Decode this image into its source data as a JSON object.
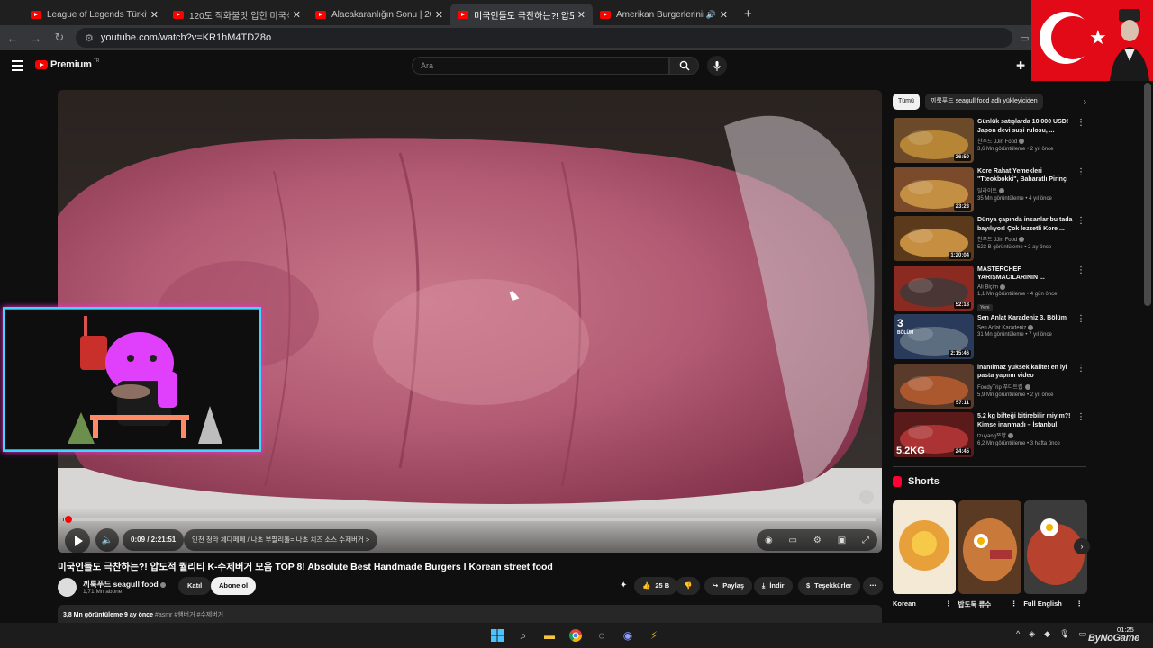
{
  "browser": {
    "tabs": [
      {
        "title": "League of Legends Türkiye - Yo",
        "active": false,
        "audio": false
      },
      {
        "title": "120도 직화불맛 입힌 미국식 옥",
        "active": false,
        "audio": false
      },
      {
        "title": "Alacakaranlığın Sonu | 2025 3.",
        "active": false,
        "audio": false
      },
      {
        "title": "미국인들도 극찬하는?! 압도적",
        "active": true,
        "audio": false
      },
      {
        "title": "Amerikan Burgerlerinin Kral",
        "active": false,
        "audio": true
      }
    ],
    "url": "youtube.com/watch?v=KR1hM4TDZ8o"
  },
  "youtube": {
    "logo": "Premium",
    "logo_region": "TR",
    "search_placeholder": "Ara"
  },
  "player": {
    "time": "0:09 / 2:21:51",
    "chapter": "인천 청라 체다페페 / 나초 부팔리톨= 나초 치즈 소스 수제버거 >",
    "progress_fraction": 0.0016
  },
  "video": {
    "title": "미국인들도 극찬하는?! 압도적 퀄리티 K-수제버거 모음 TOP 8! Absolute Best Handmade Burgers l Korean street food",
    "channel": "끼룩푸드 seagull food",
    "subscribers": "1,71 Mn abone",
    "join": "Katıl",
    "subscribe": "Abone ol",
    "likes": "25 B",
    "share": "Paylaş",
    "download": "İndir",
    "thanks": "Teşekkürler",
    "views_date": "3,8 Mn görüntüleme  9 ay önce",
    "tags": "#asmr #햄버거 #수제버거"
  },
  "sidebar": {
    "chips": [
      "Tümü",
      "끼룩푸드 seagull food adlı yükleyiciden"
    ],
    "recommendations": [
      {
        "title": "Günlük satışlarda 10.000 USD! Japon devi suşi rulosu, ...",
        "channel": "찬푸드 JJin Food",
        "meta": "3,6 Mn görüntüleme • 2 yıl önce",
        "duration": "26:50",
        "badge": ""
      },
      {
        "title": "Kore Rahat Yemekleri \"Tteokbokki\", Baharatlı Pirinç ...",
        "channel": "딜라이트",
        "meta": "35 Mn görüntüleme • 4 yıl önce",
        "duration": "23:23",
        "badge": ""
      },
      {
        "title": "Dünya çapında insanlar bu tada bayılıyor! Çok lezzetli Kore ...",
        "channel": "찬푸드 JJin Food",
        "meta": "523 B görüntüleme • 2 ay önce",
        "duration": "1:20:04",
        "badge": ""
      },
      {
        "title": "MASTERCHEF YARIŞMACILARININ ...",
        "channel": "Ali Biçim",
        "meta": "1,1 Mn görüntüleme • 4 gün önce",
        "duration": "52:18",
        "badge": "Yeni"
      },
      {
        "title": "Sen Anlat Karadeniz 3. Bölüm",
        "channel": "Sen Anlat Karadeniz",
        "meta": "31 Mn görüntüleme • 7 yıl önce",
        "duration": "2:15:46",
        "badge": ""
      },
      {
        "title": "inanılmaz yüksek kalite! en iyi pasta yapımı video koleksiyon...",
        "channel": "FoodyTrip 푸디트립",
        "meta": "5,9 Mn görüntüleme • 2 yıl önce",
        "duration": "57:11",
        "badge": ""
      },
      {
        "title": "5.2 kg bifteği bitirebilir miyim?! Kimse inanmadı – İstanbul Sal...",
        "channel": "tzuyang쯔양",
        "meta": "6,2 Mn görüntüleme • 3 hafta önce",
        "duration": "24:45",
        "badge": ""
      }
    ],
    "thumb_text": {
      "r4": "3",
      "r4b": "BÖLÜM",
      "r7": "5.2KG"
    },
    "shorts_title": "Shorts",
    "shorts": [
      {
        "label": "Korean"
      },
      {
        "label": "밥도둑 류수"
      },
      {
        "label": "Full English"
      }
    ]
  },
  "taskbar": {
    "time": "01:25"
  },
  "watermark": "ByNoGame",
  "colors": {
    "accent": "#ff0000",
    "background": "#0f0f0f",
    "overlay_border": "#3cd6ff"
  }
}
